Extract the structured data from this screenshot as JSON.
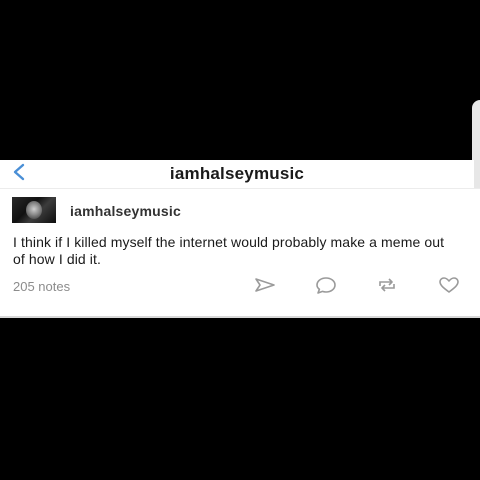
{
  "nav": {
    "title": "iamhalseymusic",
    "back_icon": "chevron-left-icon",
    "accent_color": "#4a8fd6"
  },
  "post": {
    "username": "iamhalseymusic",
    "body": "I think if I killed myself the internet would probably make a meme out of how I did it.",
    "notes": "205 notes",
    "actions": [
      "share-icon",
      "reply-icon",
      "reblog-icon",
      "like-icon"
    ]
  }
}
